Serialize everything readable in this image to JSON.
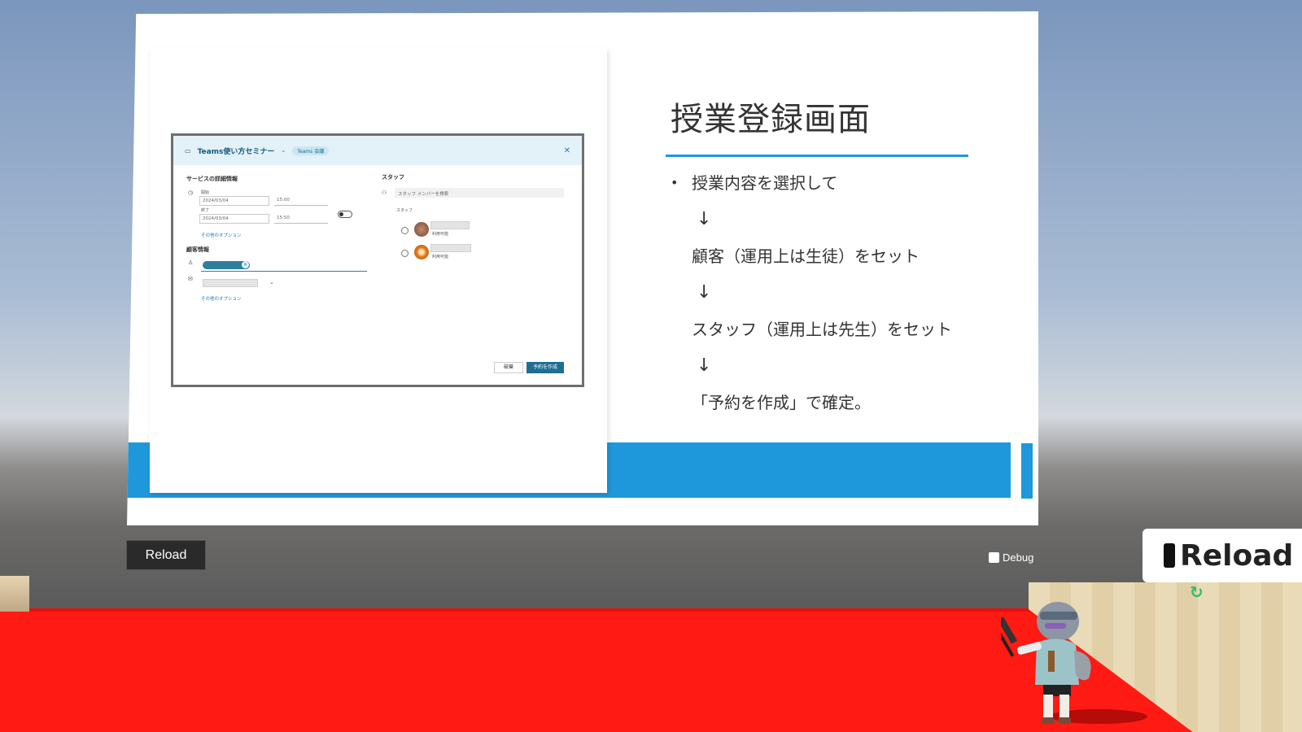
{
  "slide": {
    "title": "授業登録画面",
    "lines": [
      "授業内容を選択して",
      "↓",
      "顧客（運用上は生徒）をセット",
      "↓",
      "スタッフ（運用上は先生）をセット",
      "↓",
      "「予約を作成」で確定。"
    ],
    "accent_color": "#1e98da",
    "screenshot": {
      "dialog_title": "Teams使い方セミナー",
      "badge": "Teams 会議",
      "service_section": "サービスの詳細情報",
      "start_label": "開始",
      "start_date": "2024/03/04",
      "start_time": "15:00",
      "end_label": "終了",
      "end_date": "2024/03/04",
      "end_time": "15:50",
      "more_options_1": "その他のオプション",
      "customer_section": "顧客情報",
      "more_options_2": "その他のオプション",
      "staff_section": "スタッフ",
      "staff_search_placeholder": "スタッフ メンバーを検索",
      "staff_label": "スタッフ",
      "staff_status_1": "利用可能",
      "staff_status_2": "利用可能",
      "discard_button": "破棄",
      "create_button": "予約を作成",
      "primary_color": "#1e6e94"
    }
  },
  "controls": {
    "reload_button": "Reload",
    "debug_label": "Debug",
    "debug_checked": false,
    "reload_panel_label": "Reload"
  }
}
